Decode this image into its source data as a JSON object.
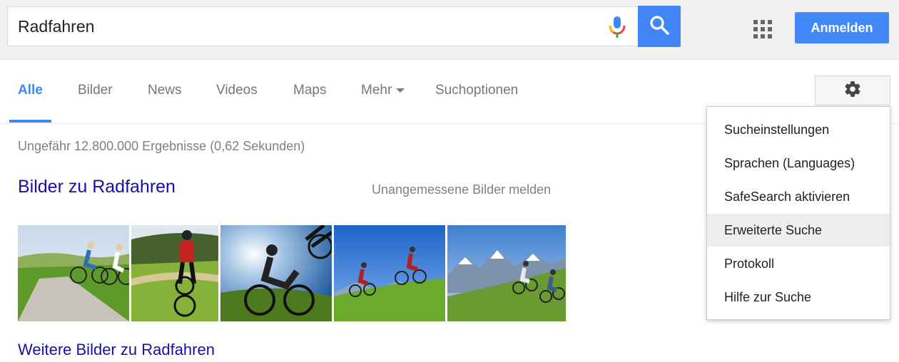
{
  "search": {
    "query": "Radfahren",
    "button_color": "#4285f4"
  },
  "icons": {
    "mic": "microphone-icon",
    "search": "search-icon",
    "apps": "apps-grid-icon",
    "settings": "gear-icon",
    "more_caret": "caret-down-icon"
  },
  "header": {
    "signin_label": "Anmelden",
    "signin_color": "#4387fd"
  },
  "tabs": [
    {
      "label": "Alle",
      "active": true
    },
    {
      "label": "Bilder",
      "active": false
    },
    {
      "label": "News",
      "active": false
    },
    {
      "label": "Videos",
      "active": false
    },
    {
      "label": "Maps",
      "active": false
    },
    {
      "label": "Mehr",
      "active": false
    },
    {
      "label": "Suchoptionen",
      "active": false
    }
  ],
  "results": {
    "stats": "Ungefähr 12.800.000 Ergebnisse (0,62 Sekunden)",
    "images_heading": "Bilder zu Radfahren",
    "report_link": "Unangemessene Bilder melden",
    "more_images": "Weitere Bilder zu Radfahren",
    "link_color": "#1a0dab"
  },
  "thumbnails": [
    {
      "subject": "two cyclists on a country path"
    },
    {
      "subject": "cyclist in red jersey on meadow"
    },
    {
      "subject": "silhouetted mountain biker against blue sky"
    },
    {
      "subject": "two mountain bikers on green hill"
    },
    {
      "subject": "mountain bikers with alpine panorama"
    }
  ],
  "settings_menu": {
    "items": [
      {
        "label": "Sucheinstellungen",
        "highlighted": false
      },
      {
        "label": "Sprachen  (Languages)",
        "highlighted": false
      },
      {
        "label": "SafeSearch aktivieren",
        "highlighted": false
      },
      {
        "label": "Erweiterte Suche",
        "highlighted": true
      },
      {
        "label": "Protokoll",
        "highlighted": false
      },
      {
        "label": "Hilfe zur Suche",
        "highlighted": false
      }
    ]
  }
}
